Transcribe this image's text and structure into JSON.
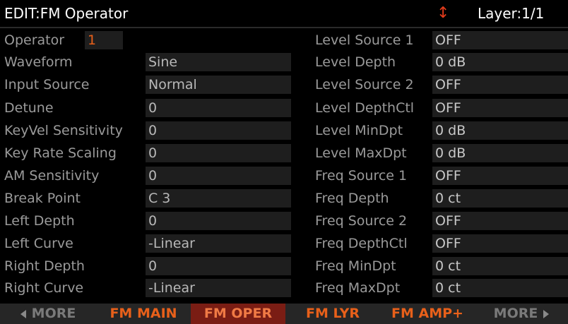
{
  "header": {
    "title": "EDIT:FM Operator",
    "layer": "Layer:1/1",
    "updown_icon": "up-down-arrow-icon"
  },
  "operator": {
    "label": "Operator",
    "value": "1"
  },
  "left_params": [
    {
      "label": "Waveform",
      "value": "Sine"
    },
    {
      "label": "Input Source",
      "value": "Normal"
    },
    {
      "label": "Detune",
      "value": "0"
    },
    {
      "label": "KeyVel Sensitivity",
      "value": "0"
    },
    {
      "label": "Key Rate Scaling",
      "value": "0"
    },
    {
      "label": "AM Sensitivity",
      "value": "0"
    },
    {
      "label": "Break Point",
      "value": "C 3"
    },
    {
      "label": "Left Depth",
      "value": "0"
    },
    {
      "label": "Left Curve",
      "value": "-Linear"
    },
    {
      "label": "Right Depth",
      "value": "0"
    },
    {
      "label": "Right Curve",
      "value": "-Linear"
    }
  ],
  "right_params": [
    {
      "label": "Level Source 1",
      "value": "OFF"
    },
    {
      "label": "Level Depth",
      "value": "0 dB"
    },
    {
      "label": "Level Source 2",
      "value": "OFF"
    },
    {
      "label": "Level DepthCtl",
      "value": "OFF"
    },
    {
      "label": "Level MinDpt",
      "value": "0 dB"
    },
    {
      "label": "Level MaxDpt",
      "value": "0 dB"
    },
    {
      "label": "Freq Source 1",
      "value": "OFF"
    },
    {
      "label": "Freq Depth",
      "value": "0 ct"
    },
    {
      "label": "Freq Source 2",
      "value": "OFF"
    },
    {
      "label": "Freq DepthCtl",
      "value": "OFF"
    },
    {
      "label": "Freq MinDpt",
      "value": "0 ct"
    },
    {
      "label": "Freq MaxDpt",
      "value": "0 ct"
    }
  ],
  "softbuttons": [
    {
      "label": "MORE",
      "kind": "more-left"
    },
    {
      "label": "FM MAIN",
      "kind": "normal"
    },
    {
      "label": "FM OPER",
      "kind": "active"
    },
    {
      "label": "FM LYR",
      "kind": "normal"
    },
    {
      "label": "FM AMP+",
      "kind": "normal"
    },
    {
      "label": "MORE",
      "kind": "more-right"
    }
  ],
  "colors": {
    "accent": "#e8601a",
    "active_tab_bg": "#7a1d14",
    "field_bg": "#1e1e1e"
  }
}
